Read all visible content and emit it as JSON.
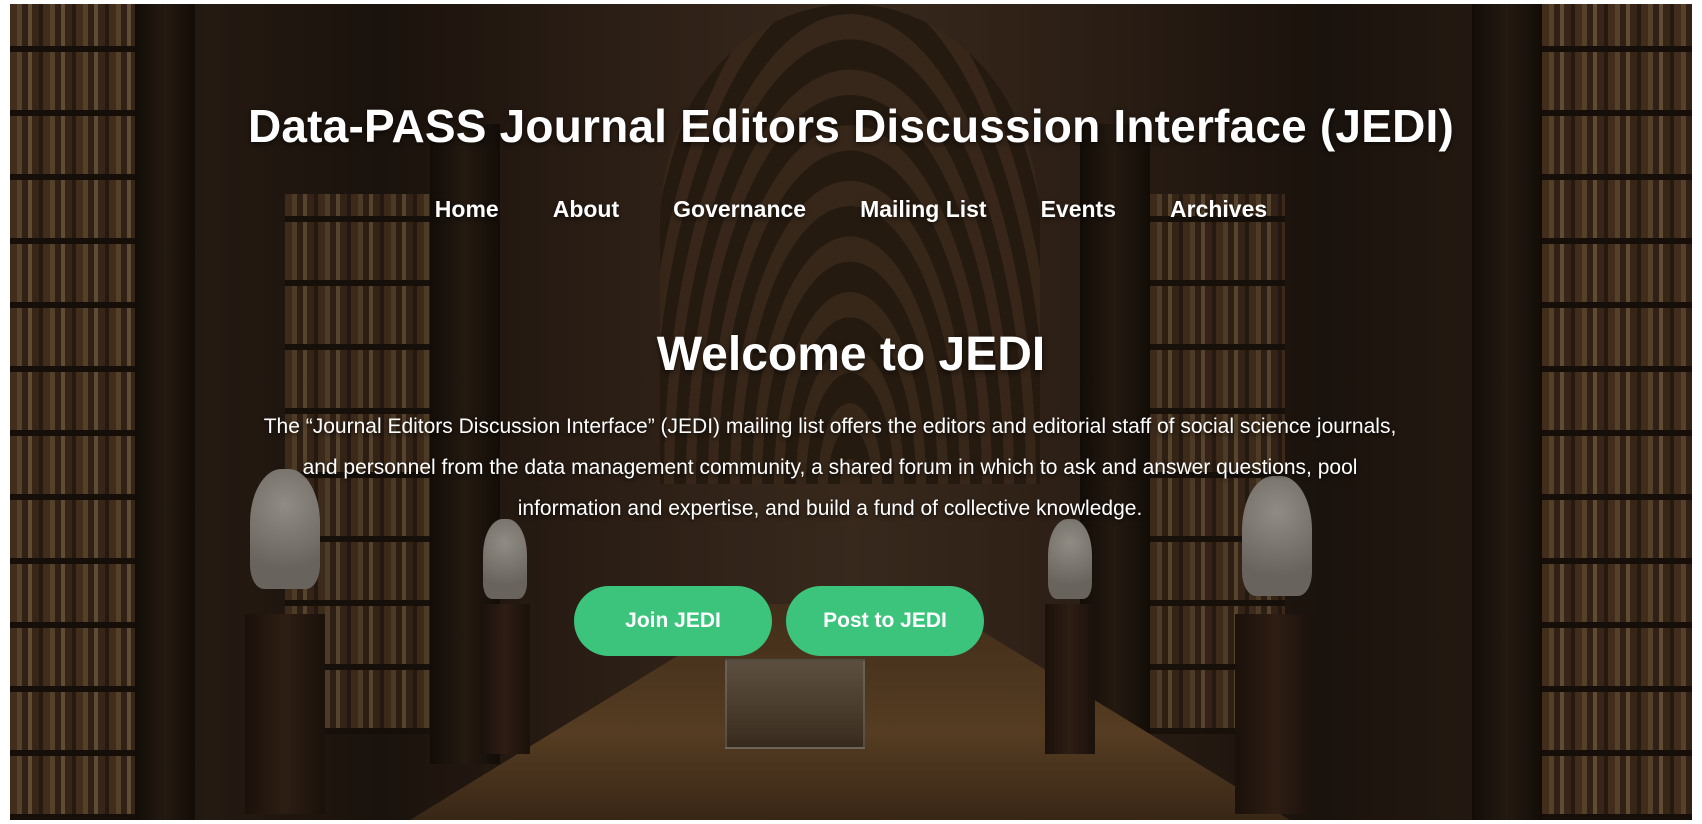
{
  "site": {
    "title": "Data-PASS Journal Editors Discussion Interface (JEDI)"
  },
  "nav": {
    "items": [
      {
        "label": "Home"
      },
      {
        "label": "About"
      },
      {
        "label": "Governance"
      },
      {
        "label": "Mailing List"
      },
      {
        "label": "Events"
      },
      {
        "label": "Archives"
      }
    ]
  },
  "hero": {
    "heading": "Welcome to JEDI",
    "intro": "The “Journal Editors Discussion Interface” (JEDI) mailing list offers the editors and editorial staff of social science journals, and personnel from the data management community, a shared forum in which to ask and answer questions, pool information and expertise, and build a fund of collective knowledge.",
    "buttons": {
      "join_label": "Join JEDI",
      "post_label": "Post to JEDI"
    }
  },
  "colors": {
    "button": "#3cc47c",
    "text": "#ffffff"
  }
}
